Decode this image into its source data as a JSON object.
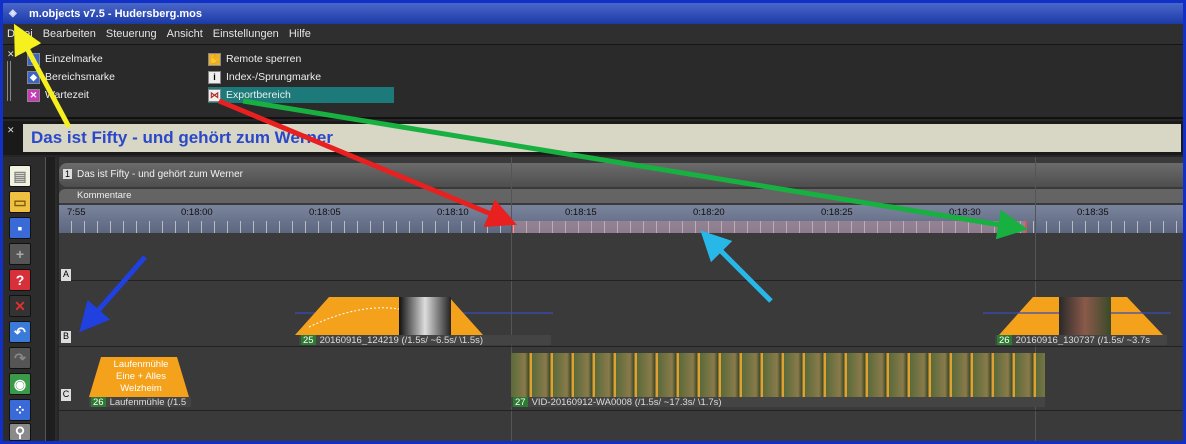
{
  "window": {
    "title": "m.objects v7.5 - Hudersberg.mos"
  },
  "menu": [
    "Datei",
    "Bearbeiten",
    "Steuerung",
    "Ansicht",
    "Einstellungen",
    "Hilfe"
  ],
  "markers": {
    "left": [
      "Einzelmarke",
      "Bereichsmarke",
      "Wartezeit"
    ],
    "right": [
      "Remote sperren",
      "Index-/Sprungmarke",
      "Exportbereich"
    ]
  },
  "show_title": "Das ist Fifty - und gehört zum Werner",
  "track": {
    "number": "1",
    "title": "Das ist Fifty - und gehört zum Werner",
    "kommentare": "Kommentare"
  },
  "ruler": [
    "7:55",
    "0:18:00",
    "0:18:05",
    "0:18:10",
    "0:18:15",
    "0:18:20",
    "0:18:25",
    "0:18:30",
    "0:18:35"
  ],
  "lanes": [
    "A",
    "B",
    "C"
  ],
  "clips": {
    "b1": {
      "num": "25",
      "label": "20160916_124219 (/1.5s/ ~6.5s/ \\1.5s)"
    },
    "b2": {
      "num": "26",
      "label": "20160916_130737 (/1.5s/ ~3.7s"
    },
    "c1": {
      "num": "26",
      "label": "Laufenmühle (/1.5"
    },
    "c1_text": [
      "Laufenmühle",
      "Eine + Alles",
      "Welzheim"
    ],
    "c2": {
      "num": "27",
      "label": "VID-20160912-WA0008 (/1.5s/ ~17.3s/ \\1.7s)"
    }
  },
  "colors": {
    "accent": "#f4a21c",
    "export": "#e05050"
  }
}
